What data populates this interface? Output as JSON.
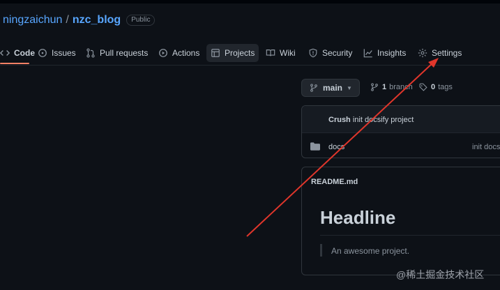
{
  "repo": {
    "owner": "ningzaichun",
    "separator": "/",
    "name": "nzc_blog",
    "visibility": "Public"
  },
  "tabs": [
    {
      "label": "Code",
      "icon": "code-icon",
      "active": true
    },
    {
      "label": "Issues",
      "icon": "issue-icon"
    },
    {
      "label": "Pull requests",
      "icon": "pull-request-icon"
    },
    {
      "label": "Actions",
      "icon": "play-icon"
    },
    {
      "label": "Projects",
      "icon": "table-icon"
    },
    {
      "label": "Wiki",
      "icon": "book-icon"
    },
    {
      "label": "Security",
      "icon": "shield-icon"
    },
    {
      "label": "Insights",
      "icon": "graph-icon"
    },
    {
      "label": "Settings",
      "icon": "gear-icon"
    }
  ],
  "branch": {
    "current": "main",
    "branch_count": "1",
    "branch_label": "branch",
    "tag_count": "0",
    "tag_label": "tags"
  },
  "commit": {
    "author": "Crush",
    "message": "init docsify project"
  },
  "files": [
    {
      "name": "docs",
      "type": "folder",
      "message": "init docs"
    }
  ],
  "readme": {
    "filename": "README.md",
    "headline": "Headline",
    "quote": "An awesome project."
  },
  "annotation": {
    "arrow_color": "#e0362b"
  },
  "watermark": "@稀土掘金技术社区",
  "colors": {
    "background": "#0d1117",
    "link": "#58a6ff",
    "accent_underline": "#f78166",
    "muted": "#8b949e"
  }
}
